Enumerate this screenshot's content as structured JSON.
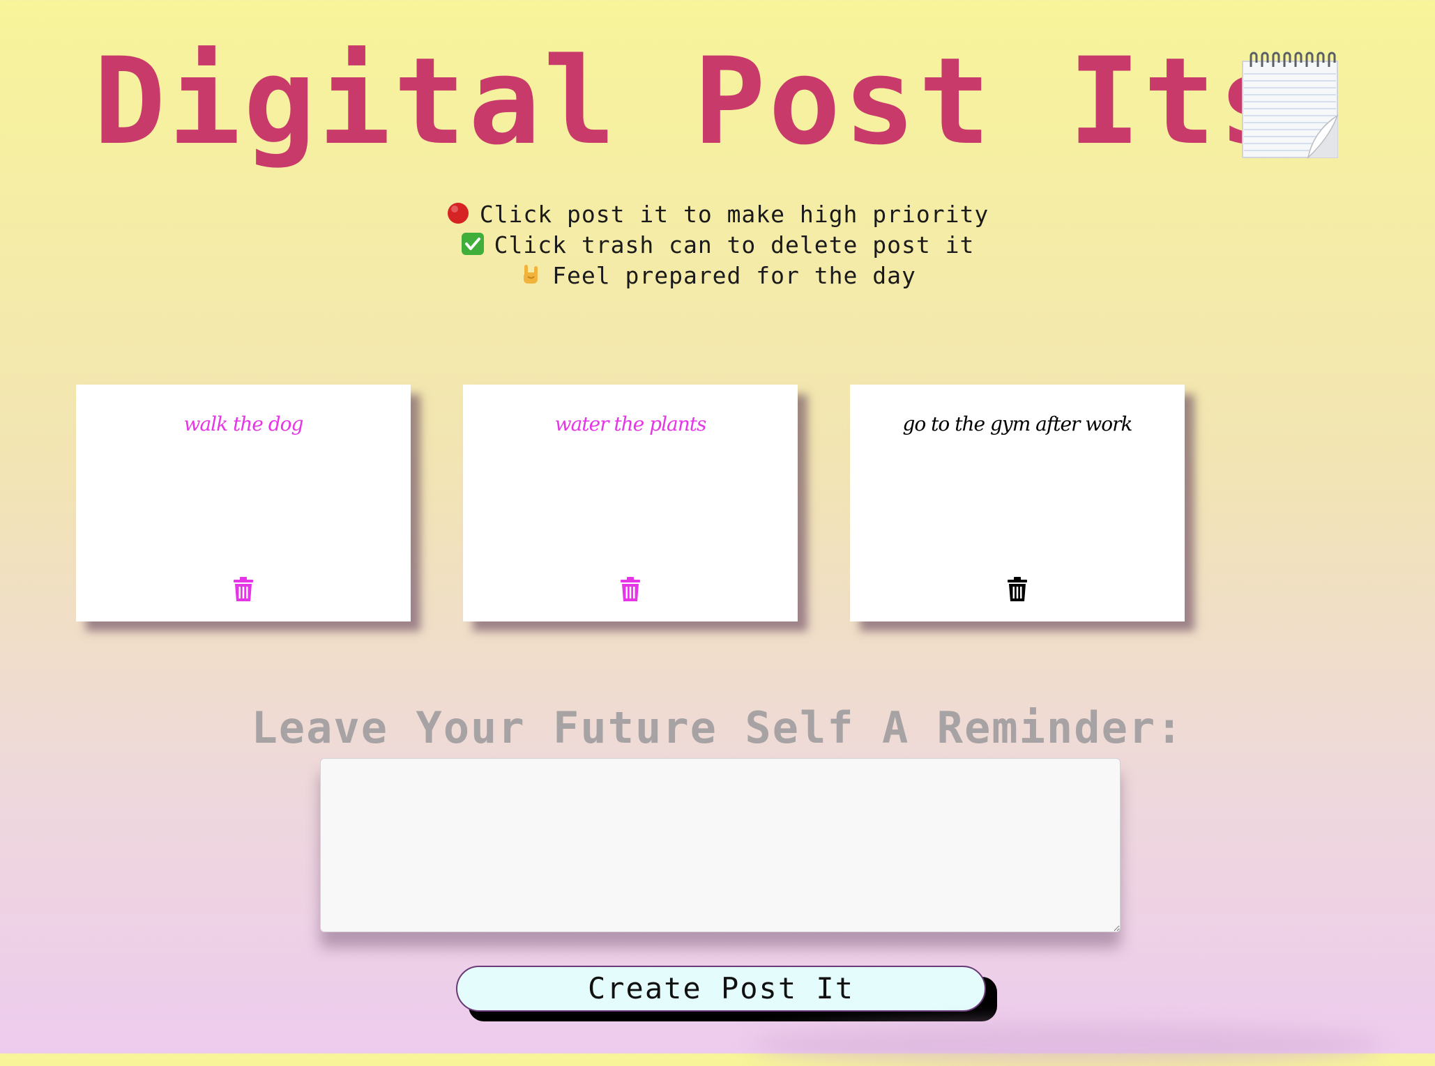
{
  "header": {
    "title": "Digital Post Its",
    "icon": "notepad-icon"
  },
  "instructions": [
    {
      "icon": "red-circle-icon",
      "text": "Click post it to make high priority"
    },
    {
      "icon": "check-mark-icon",
      "text": "Click trash can to delete post it"
    },
    {
      "icon": "rock-on-hand-icon",
      "text": "Feel prepared for the day"
    }
  ],
  "notes": [
    {
      "text": "walk the dog",
      "color": "#e535e6",
      "priority": "high"
    },
    {
      "text": "water the plants",
      "color": "#e535e6",
      "priority": "high"
    },
    {
      "text": "go to the gym after work",
      "color": "#000000",
      "priority": "normal"
    }
  ],
  "reminder": {
    "label": "Leave Your Future Self A Reminder:",
    "value": "",
    "button_label": "Create Post It"
  },
  "colors": {
    "title": "#c83a6a",
    "priority_note": "#e535e6",
    "button_background": "#e4fcfc",
    "label": "#a7a3a4"
  }
}
